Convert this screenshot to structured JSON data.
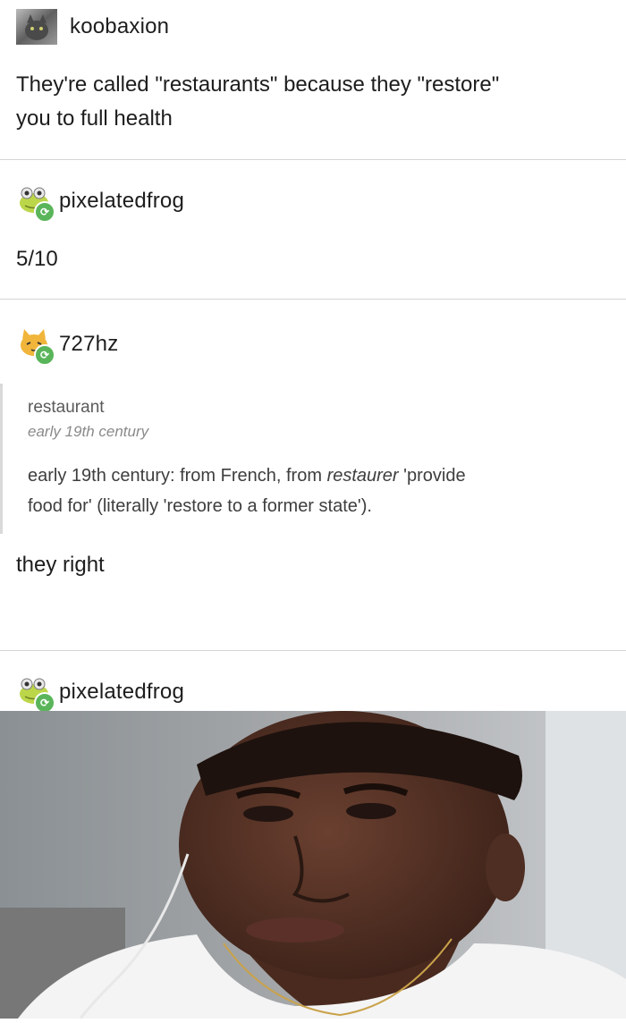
{
  "posts": [
    {
      "username": "koobaxion",
      "avatar": "cat-avatar-icon",
      "text_line1": "They're called \"restaurants\" because they \"restore\"",
      "text_line2": "you to full health"
    },
    {
      "username": "pixelatedfrog",
      "avatar": "frog-avatar-icon",
      "text": "5/10"
    },
    {
      "username": "727hz",
      "avatar": "cat-face-avatar-icon",
      "quote": {
        "word": "restaurant",
        "era": "early 19th century",
        "definition_line1_start": "early 19th century: from French, from ",
        "definition_line1_italic": "restaurer",
        "definition_line1_end": " 'provide",
        "definition_line2": "food for' (literally 'restore to a former state')."
      },
      "text": "they right"
    },
    {
      "username": "pixelatedfrog",
      "avatar": "frog-avatar-icon",
      "image": "photo-of-young-man-with-earphones"
    }
  ],
  "colors": {
    "reblog_green": "#5ab55a",
    "divider": "#d4d4d4",
    "text": "#1d1d1d"
  }
}
